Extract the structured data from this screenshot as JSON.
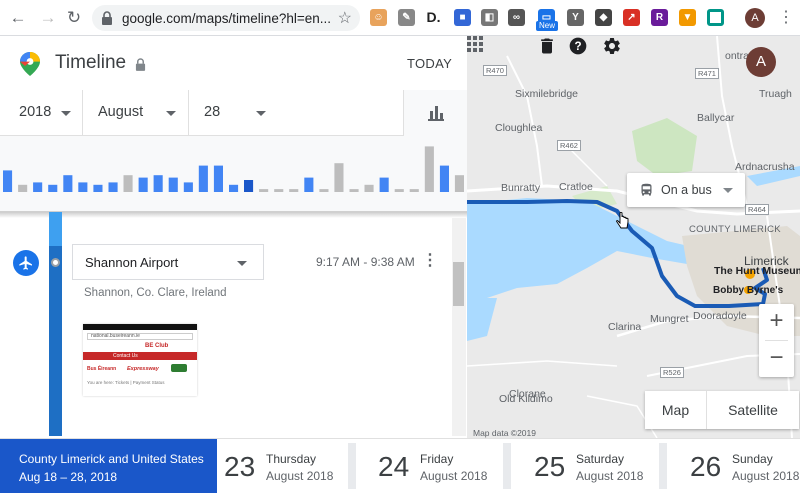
{
  "browser": {
    "url": "google.com/maps/timeline?hl=en...",
    "profile_initial": "A",
    "new_badge": "New"
  },
  "timeline": {
    "title": "Timeline",
    "today_label": "TODAY",
    "year": "2018",
    "month": "August",
    "day": "28"
  },
  "histogram": {
    "bars": [
      {
        "v": 0.45,
        "c": "#4285f4"
      },
      {
        "v": 0.15,
        "c": "#bdbdbd"
      },
      {
        "v": 0.2,
        "c": "#4285f4"
      },
      {
        "v": 0.15,
        "c": "#4285f4"
      },
      {
        "v": 0.35,
        "c": "#4285f4"
      },
      {
        "v": 0.2,
        "c": "#4285f4"
      },
      {
        "v": 0.15,
        "c": "#4285f4"
      },
      {
        "v": 0.2,
        "c": "#4285f4"
      },
      {
        "v": 0.35,
        "c": "#bdbdbd"
      },
      {
        "v": 0.3,
        "c": "#4285f4"
      },
      {
        "v": 0.35,
        "c": "#4285f4"
      },
      {
        "v": 0.3,
        "c": "#4285f4"
      },
      {
        "v": 0.2,
        "c": "#4285f4"
      },
      {
        "v": 0.55,
        "c": "#4285f4"
      },
      {
        "v": 0.55,
        "c": "#4285f4"
      },
      {
        "v": 0.15,
        "c": "#4285f4"
      },
      {
        "v": 0.25,
        "c": "#1a57c9"
      },
      {
        "v": 0.06,
        "c": "#bdbdbd"
      },
      {
        "v": 0.06,
        "c": "#bdbdbd"
      },
      {
        "v": 0.06,
        "c": "#bdbdbd"
      },
      {
        "v": 0.3,
        "c": "#4285f4"
      },
      {
        "v": 0.06,
        "c": "#bdbdbd"
      },
      {
        "v": 0.6,
        "c": "#bdbdbd"
      },
      {
        "v": 0.06,
        "c": "#bdbdbd"
      },
      {
        "v": 0.15,
        "c": "#bdbdbd"
      },
      {
        "v": 0.3,
        "c": "#4285f4"
      },
      {
        "v": 0.06,
        "c": "#bdbdbd"
      },
      {
        "v": 0.06,
        "c": "#bdbdbd"
      },
      {
        "v": 0.95,
        "c": "#bdbdbd"
      },
      {
        "v": 0.55,
        "c": "#4285f4"
      },
      {
        "v": 0.35,
        "c": "#bdbdbd"
      }
    ]
  },
  "place": {
    "name": "Shannon Airport",
    "time": "9:17 AM - 9:38 AM",
    "address": "Shannon, Co. Clare, Ireland"
  },
  "photo": {
    "site": "national.buseireann.ie",
    "brand": "BE Club",
    "nav_contact": "Contact Us",
    "logo1": "Bus Éireann",
    "logo2": "Expressway",
    "crumb": "You are here: Tickets | Payment Status"
  },
  "map": {
    "chip_label": "On a bus",
    "avatar_initial": "A",
    "map_btn": "Map",
    "satellite_btn": "Satellite",
    "map_data": "Map data ©2019",
    "zoom_in": "+",
    "zoom_out": "−",
    "labels": {
      "sixmilebridge": "Sixmilebridge",
      "truagh": "Truagh",
      "ballycar": "Ballycar",
      "cloughlea": "Cloughlea",
      "ardnacrusha": "Ardnacrusha",
      "bunratty": "Bunratty",
      "cratloe": "Cratloe",
      "county_limerick": "COUNTY LIMERICK",
      "limerick": "Limerick",
      "hunt_museum": "The Hunt Museum",
      "bobby_byrnes": "Bobby Byrne's",
      "clarina": "Clarina",
      "mungret": "Mungret",
      "dooradoyle": "Dooradoyle",
      "old_kildimo": "Old Kildimo",
      "clorane": "Clorane",
      "ontra": "ontra"
    },
    "roads": {
      "r470": "R470",
      "r471": "R471",
      "r462": "R462",
      "r464": "R464",
      "r526": "R526"
    }
  },
  "bottom": {
    "range_title": "County Limerick and United States",
    "range_dates": "Aug 18 – 28, 2018",
    "days": [
      {
        "num": "23",
        "weekday": "Thursday",
        "month": "August 2018"
      },
      {
        "num": "24",
        "weekday": "Friday",
        "month": "August 2018"
      },
      {
        "num": "25",
        "weekday": "Saturday",
        "month": "August 2018"
      },
      {
        "num": "26",
        "weekday": "Sunday",
        "month": "August 2018"
      }
    ]
  }
}
